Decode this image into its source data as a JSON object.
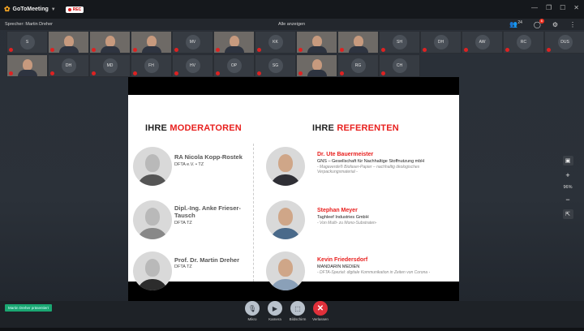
{
  "app": {
    "name": "GoToMeeting",
    "rec_label": "REC"
  },
  "speakerbar": {
    "speaker_text": "Sprecher: Martin Dreher",
    "show_all": "Alle anzeigen",
    "people_count": "24",
    "chat_badge": "6"
  },
  "tiles": [
    {
      "initials": "S",
      "type": "avatar"
    },
    {
      "initials": "",
      "type": "video"
    },
    {
      "initials": "",
      "type": "video"
    },
    {
      "initials": "",
      "type": "video"
    },
    {
      "initials": "MV",
      "type": "avatar"
    },
    {
      "initials": "",
      "type": "video"
    },
    {
      "initials": "KK",
      "type": "avatar"
    },
    {
      "initials": "",
      "type": "video"
    },
    {
      "initials": "",
      "type": "video"
    },
    {
      "initials": "SH",
      "type": "avatar"
    },
    {
      "initials": "DH",
      "type": "avatar"
    },
    {
      "initials": "AW",
      "type": "avatar"
    },
    {
      "initials": "RC",
      "type": "avatar"
    },
    {
      "initials": "DUS",
      "type": "avatar"
    },
    {
      "initials": "",
      "type": "video"
    },
    {
      "initials": "DH",
      "type": "avatar"
    },
    {
      "initials": "MD",
      "type": "avatar"
    },
    {
      "initials": "FH",
      "type": "avatar"
    },
    {
      "initials": "HV",
      "type": "avatar"
    },
    {
      "initials": "OP",
      "type": "avatar"
    },
    {
      "initials": "SG",
      "type": "avatar"
    },
    {
      "initials": "",
      "type": "video"
    },
    {
      "initials": "RG",
      "type": "avatar"
    },
    {
      "initials": "CH",
      "type": "avatar"
    }
  ],
  "slide": {
    "moderators_title_a": "IHRE ",
    "moderators_title_b": "MODERATOREN",
    "speakers_title_a": "IHRE ",
    "speakers_title_b": "REFERENTEN",
    "moderators": [
      {
        "name": "RA Nicola Kopp-Rostek",
        "org": "DFTA e.V. • TZ"
      },
      {
        "name": "Dipl.-Ing. Anke Frieser-Tausch",
        "org": "DFTA TZ"
      },
      {
        "name": "Prof. Dr. Martin Dreher",
        "org": "DFTA TZ"
      }
    ],
    "speakers": [
      {
        "name": "Dr. Ute Bauermeister",
        "org": "GNS – Gesellschaft für Nachhaltige Stoffnutzung mbH",
        "topic": "- Magaverde® Biofaser-Papier – nachhaltig ökologisches Verpackungsmaterial -"
      },
      {
        "name": "Stephan Meyer",
        "org": "Taghleef Industries GmbH",
        "topic": "- Von Multi- zu Mono-Substraten-"
      },
      {
        "name": "Kevin Friedersdorf",
        "org": "MANDARIN MEDIEN",
        "topic": "- DFTA-Spezial: digitale Kommunikation in Zeiten von Corona -"
      }
    ]
  },
  "side_controls": {
    "zoom": "96%"
  },
  "bottom": {
    "status_pill": "Martin Dreher präsentiert",
    "buttons": [
      {
        "label": "Mikro"
      },
      {
        "label": "Kamera"
      },
      {
        "label": "Bildschirm"
      },
      {
        "label": "Verlassen"
      }
    ]
  }
}
